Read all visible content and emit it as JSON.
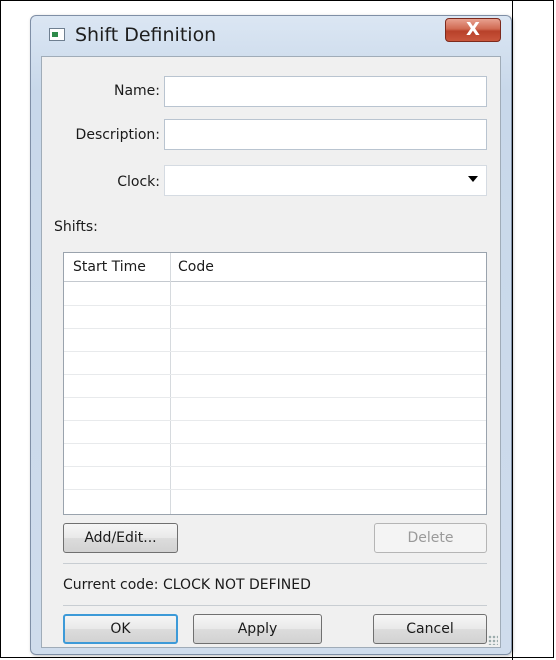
{
  "window": {
    "title": "Shift Definition",
    "close_glyph": "X"
  },
  "form": {
    "name_label": "Name:",
    "name_value": "",
    "description_label": "Description:",
    "description_value": "",
    "clock_label": "Clock:",
    "clock_value": "",
    "shifts_label": "Shifts:"
  },
  "shifts_table": {
    "columns": [
      "Start Time",
      "Code"
    ],
    "rows": []
  },
  "buttons": {
    "add_edit": "Add/Edit...",
    "delete": "Delete",
    "ok": "OK",
    "apply": "Apply",
    "cancel": "Cancel"
  },
  "status": {
    "current_code_label": "Current code:",
    "current_code_value": "CLOCK NOT DEFINED"
  },
  "icons": {
    "app": "window-app-icon",
    "close": "close-icon",
    "dropdown": "chevron-down-icon",
    "resize": "resize-grip-icon"
  },
  "colors": {
    "close_button": "#c9563c",
    "default_button_border": "#3d9ad8",
    "dialog_background": "#f0f0f0"
  }
}
